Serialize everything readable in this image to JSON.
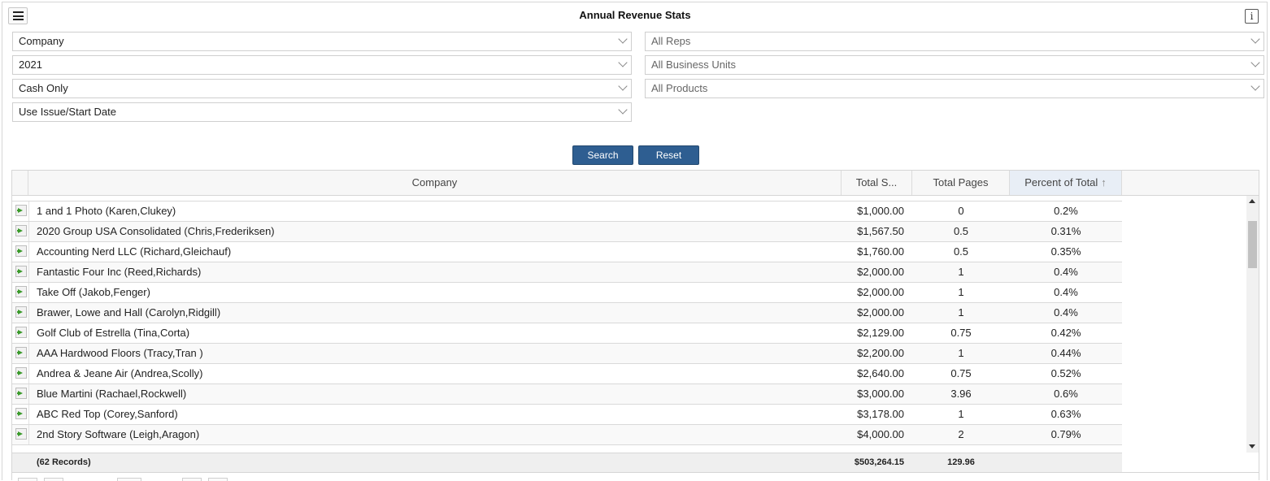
{
  "header": {
    "title": "Annual Revenue Stats",
    "menu_icon": "hamburger-icon",
    "info_icon": "info-icon",
    "info_label": "i"
  },
  "filters": {
    "left": [
      {
        "value": "Company"
      },
      {
        "value": "2021"
      },
      {
        "value": "Cash Only"
      },
      {
        "value": "Use Issue/Start Date"
      }
    ],
    "right": [
      {
        "value": "All Reps"
      },
      {
        "value": "All Business Units"
      },
      {
        "value": "All Products"
      }
    ]
  },
  "actions": {
    "search_label": "Search",
    "reset_label": "Reset",
    "button_color": "#2e5e91"
  },
  "grid": {
    "columns": {
      "company": "Company",
      "total_sales": "Total S...",
      "total_pages": "Total Pages",
      "percent": "Percent of Total",
      "sort_icon": "sort-ascending-icon"
    },
    "rows": [
      {
        "name": "1 and 1 Photo (Karen,Clukey)",
        "total": "$1,000.00",
        "pages": "0",
        "pct": "0.2%"
      },
      {
        "name": "2020 Group USA Consolidated (Chris,Frederiksen)",
        "total": "$1,567.50",
        "pages": "0.5",
        "pct": "0.31%"
      },
      {
        "name": "Accounting Nerd LLC (Richard,Gleichauf)",
        "total": "$1,760.00",
        "pages": "0.5",
        "pct": "0.35%"
      },
      {
        "name": "Fantastic Four Inc (Reed,Richards)",
        "total": "$2,000.00",
        "pages": "1",
        "pct": "0.4%"
      },
      {
        "name": "Take Off (Jakob,Fenger)",
        "total": "$2,000.00",
        "pages": "1",
        "pct": "0.4%"
      },
      {
        "name": "Brawer, Lowe and Hall (Carolyn,Ridgill)",
        "total": "$2,000.00",
        "pages": "1",
        "pct": "0.4%"
      },
      {
        "name": "Golf Club of Estrella (Tina,Corta)",
        "total": "$2,129.00",
        "pages": "0.75",
        "pct": "0.42%"
      },
      {
        "name": "AAA Hardwood Floors (Tracy,Tran )",
        "total": "$2,200.00",
        "pages": "1",
        "pct": "0.44%"
      },
      {
        "name": "Andrea & Jeane Air (Andrea,Scolly)",
        "total": "$2,640.00",
        "pages": "0.75",
        "pct": "0.52%"
      },
      {
        "name": "Blue Martini (Rachael,Rockwell)",
        "total": "$3,000.00",
        "pages": "3.96",
        "pct": "0.6%"
      },
      {
        "name": "ABC Red Top (Corey,Sanford)",
        "total": "$3,178.00",
        "pages": "1",
        "pct": "0.63%"
      },
      {
        "name": "2nd Story Software (Leigh,Aragon)",
        "total": "$4,000.00",
        "pages": "2",
        "pct": "0.79%"
      }
    ],
    "row_icon": "arrow-right-icon",
    "footer": {
      "records": "(62 Records)",
      "total": "$503,264.15",
      "pages": "129.96"
    }
  }
}
